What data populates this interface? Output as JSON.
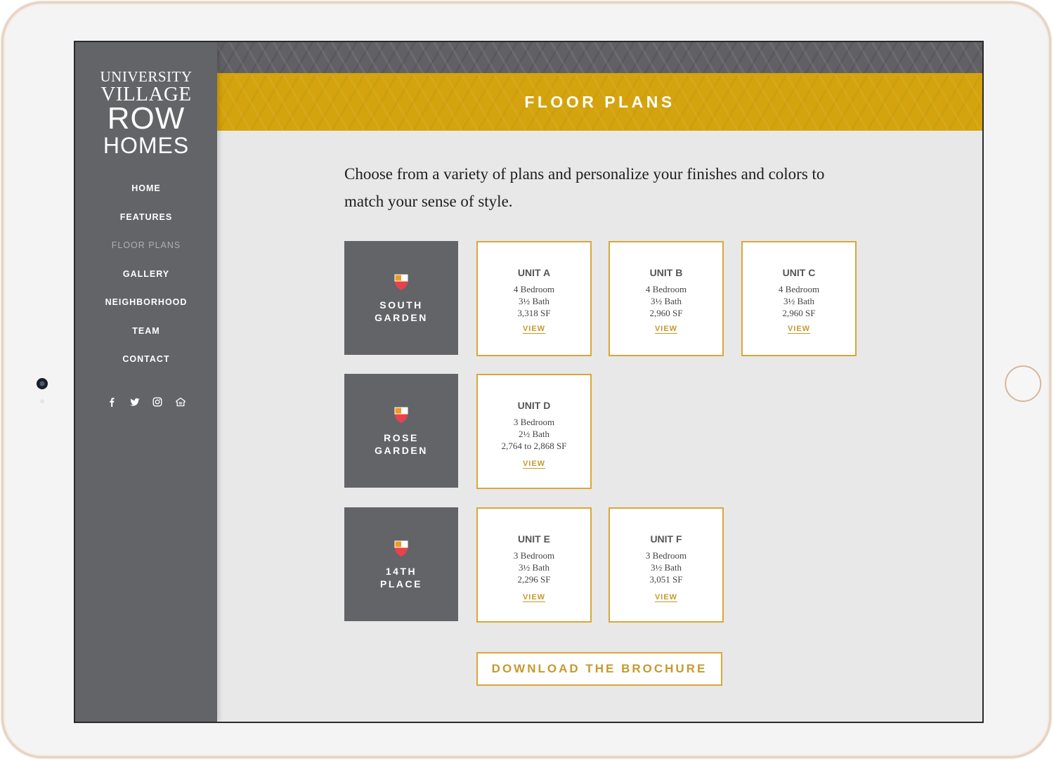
{
  "sidebar": {
    "logo": {
      "line1": "UNIVERSITY",
      "line2": "VILLAGE",
      "line3": "ROW",
      "line4": "HOMES"
    },
    "nav": [
      "HOME",
      "FEATURES",
      "FLOOR PLANS",
      "GALLERY",
      "NEIGHBORHOOD",
      "TEAM",
      "CONTACT"
    ],
    "active_nav": "FLOOR PLANS",
    "social_icons": [
      "facebook-icon",
      "twitter-icon",
      "instagram-icon",
      "equal-housing-icon"
    ]
  },
  "header": {
    "title": "FLOOR PLANS"
  },
  "intro": "Choose from a variety of plans and personalize your finishes and colors to match your sense of style.",
  "groups": [
    {
      "name_line1": "SOUTH",
      "name_line2": "GARDEN",
      "units": [
        {
          "name": "UNIT A",
          "bed": "4 Bedroom",
          "bath": "3½ Bath",
          "area": "3,318 SF",
          "link": "VIEW"
        },
        {
          "name": "UNIT B",
          "bed": "4 Bedroom",
          "bath": "3½ Bath",
          "area": "2,960 SF",
          "link": "VIEW"
        },
        {
          "name": "UNIT C",
          "bed": "4 Bedroom",
          "bath": "3½ Bath",
          "area": "2,960 SF",
          "link": "VIEW"
        }
      ]
    },
    {
      "name_line1": "ROSE",
      "name_line2": "GARDEN",
      "units": [
        {
          "name": "UNIT D",
          "bed": "3 Bedroom",
          "bath": "2½ Bath",
          "area": "2,764 to 2,868 SF",
          "link": "VIEW"
        }
      ]
    },
    {
      "name_line1": "14TH",
      "name_line2": "PLACE",
      "units": [
        {
          "name": "UNIT E",
          "bed": "3 Bedroom",
          "bath": "3½ Bath",
          "area": "2,296 SF",
          "link": "VIEW"
        },
        {
          "name": "UNIT F",
          "bed": "3 Bedroom",
          "bath": "3½ Bath",
          "area": "3,051 SF",
          "link": "VIEW"
        }
      ]
    }
  ],
  "cta": {
    "brochure_label": "DOWNLOAD THE BROCHURE"
  },
  "colors": {
    "sidebar": "#636468",
    "accent": "#d4a30d",
    "gold_text": "#c59a2e",
    "shield_red": "#e8424d",
    "shield_orange": "#f39a1e"
  }
}
